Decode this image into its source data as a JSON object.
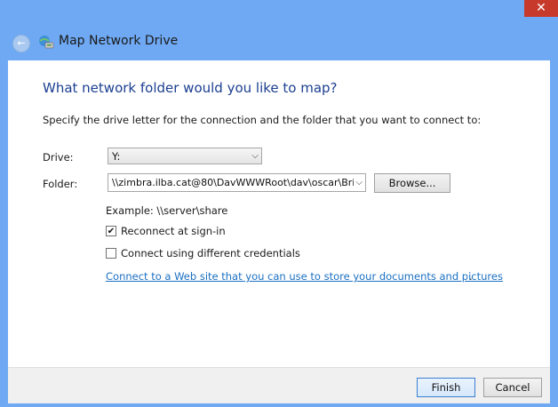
{
  "window": {
    "title": "Map Network Drive",
    "close_glyph": "✕",
    "back_glyph": "←"
  },
  "heading": "What network folder would you like to map?",
  "instruction": "Specify the drive letter for the connection and the folder that you want to connect to:",
  "drive": {
    "label": "Drive:",
    "value": "Y:"
  },
  "folder": {
    "label": "Folder:",
    "value": "\\\\zimbra.ilba.cat@80\\DavWWWRoot\\dav\\oscar\\Bri",
    "browse_label": "Browse..."
  },
  "example": "Example: \\\\server\\share",
  "options": {
    "reconnect": {
      "label": "Reconnect at sign-in",
      "checked": true,
      "mark": "✔"
    },
    "credentials": {
      "label": "Connect using different credentials",
      "checked": false
    }
  },
  "link": {
    "text": "Connect to a Web site that you can use to store your documents and pictures",
    "suffix": "."
  },
  "buttons": {
    "finish": "Finish",
    "cancel": "Cancel"
  },
  "icons": {
    "back": "back-arrow-icon",
    "network_drive": "network-drive-icon",
    "chevron": "chevron-down-icon",
    "close": "close-icon"
  },
  "colors": {
    "frame": "#6fa9f3",
    "heading": "#1b3f90",
    "link": "#1a6fc2",
    "close": "#c7392b"
  }
}
